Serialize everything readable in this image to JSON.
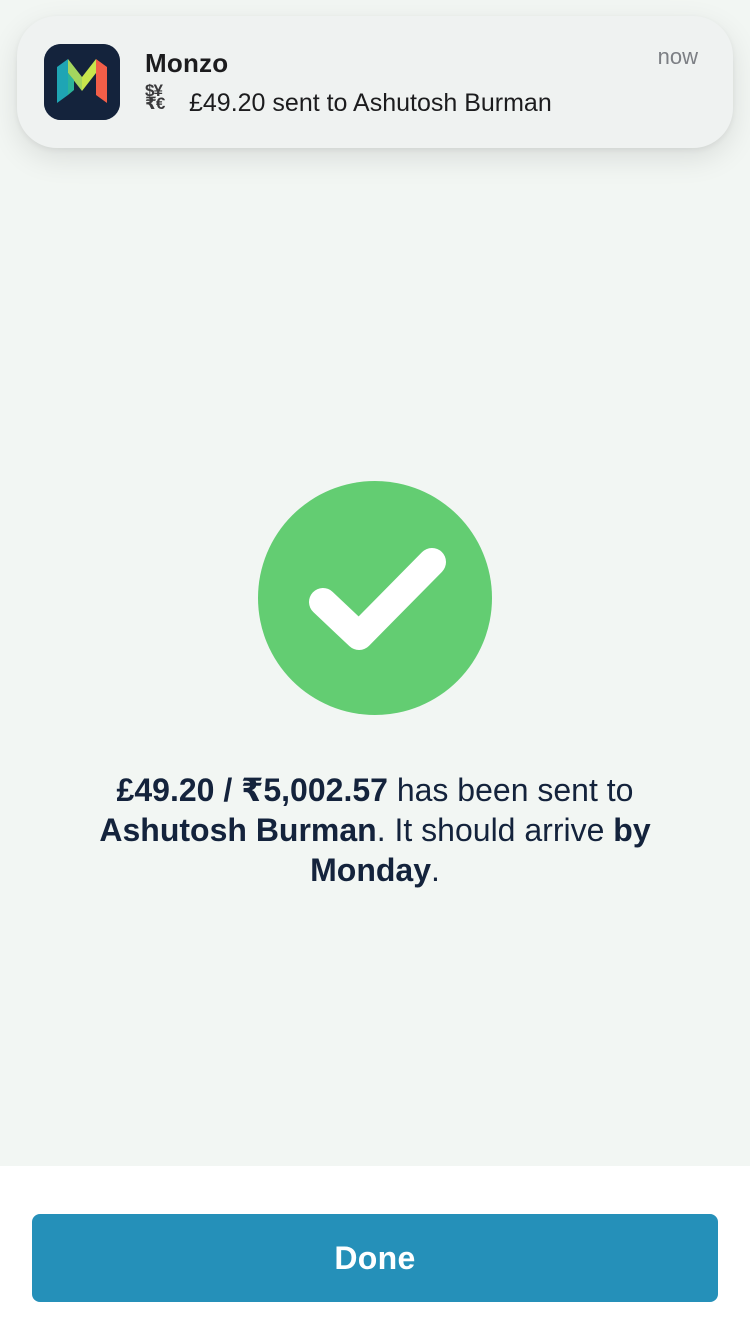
{
  "notification": {
    "app_name": "Monzo",
    "time": "now",
    "currency_icon": "currency-exchange-icon",
    "currency_icon_glyphs": [
      "$¥",
      "₹€"
    ],
    "message": "£49.20 sent to Ashutosh Burman"
  },
  "confirmation": {
    "icon": "checkmark-icon",
    "amount_gbp": "£49.20",
    "separator": " / ",
    "amount_inr": "₹5,002.57",
    "text_sent": " has been sent to ",
    "recipient": "Ashutosh Burman",
    "text_arrive": ". It should arrive ",
    "arrival": "by Monday",
    "end": "."
  },
  "actions": {
    "done_label": "Done"
  },
  "colors": {
    "background": "#f2f6f3",
    "success_green": "#63cd72",
    "primary_button": "#2590b9",
    "text": "#14233c",
    "monzo_navy": "#14233c"
  }
}
